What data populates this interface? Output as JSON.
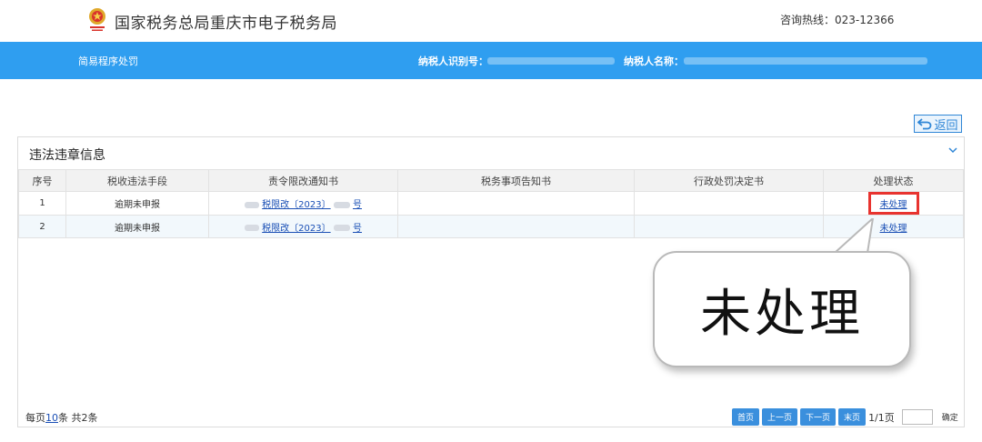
{
  "header": {
    "site_title": "国家税务总局重庆市电子税务局",
    "hotline": "咨询热线：023-12366",
    "logo_icon": "tax-emblem-icon"
  },
  "bar": {
    "title": "简易程序处罚",
    "tin_label": "纳税人识别号：",
    "name_label": "纳税人名称："
  },
  "back_button": {
    "label": "返回",
    "icon": "return-arrow-icon"
  },
  "panel": {
    "title": "违法违章信息",
    "collapse_icon": "chevron-down-icon",
    "columns": [
      "序号",
      "税收违法手段",
      "责令限改通知书",
      "税务事项告知书",
      "行政处罚决定书",
      "处理状态"
    ],
    "rows": [
      {
        "index": "1",
        "means": "逾期未申报",
        "notice_mid": "税限改〔2023〕",
        "notice_end": "号",
        "matters": "",
        "decision": "",
        "status": "未处理"
      },
      {
        "index": "2",
        "means": "逾期未申报",
        "notice_mid": "税限改〔2023〕",
        "notice_end": "号",
        "matters": "",
        "decision": "",
        "status": "未处理"
      }
    ]
  },
  "footer": {
    "per_page_prefix": "每页",
    "per_page_value": "10",
    "per_page_suffix": "条 共2条",
    "first": "首页",
    "prev": "上一页",
    "next": "下一页",
    "last": "末页",
    "page_info": "1/1页",
    "confirm": "确定"
  },
  "callout": {
    "text": "未处理"
  },
  "colors": {
    "bar_blue": "#2f9ef0",
    "highlight_red": "#e8332f",
    "link_blue": "#1a4fb5"
  }
}
